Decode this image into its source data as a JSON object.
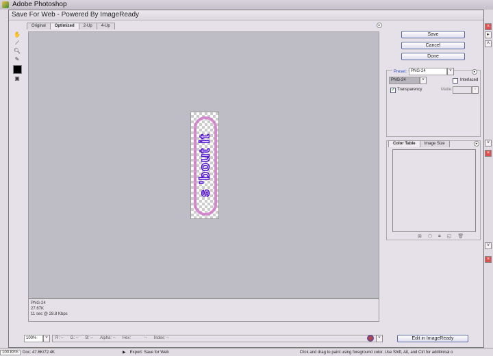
{
  "app": {
    "title": "Adobe Photoshop"
  },
  "dialog": {
    "title": "Save For Web - Powered By ImageReady"
  },
  "tabs": [
    {
      "label": "Original"
    },
    {
      "label": "Optimized"
    },
    {
      "label": "2-Up"
    },
    {
      "label": "4-Up"
    }
  ],
  "canvas": {
    "art_text": "s 'bout it"
  },
  "info": {
    "format": "PNG-24",
    "size": "27.67K",
    "time": "11 sec @ 28.8 Kbps"
  },
  "bottom": {
    "zoom": "100%",
    "r": "R:",
    "r_val": "--",
    "g": "G:",
    "g_val": "--",
    "b": "B:",
    "b_val": "--",
    "alpha": "Alpha:",
    "alpha_val": "--",
    "hex": "Hex:",
    "hex_val": "--",
    "index": "Index:",
    "index_val": "--",
    "edit_button": "Edit in ImageReady"
  },
  "buttons": {
    "save": "Save",
    "cancel": "Cancel",
    "done": "Done"
  },
  "settings": {
    "preset_label": "Preset:",
    "preset_value": "PNG-24",
    "format_value": "PNG-24",
    "interlaced_label": "Interlaced",
    "interlaced": false,
    "transparency_label": "Transparency",
    "transparency": true,
    "matte_label": "Matte:"
  },
  "color_panel": {
    "tabs": [
      {
        "label": "Color Table"
      },
      {
        "label": "Image Size"
      }
    ]
  },
  "status": {
    "zoom": "100.83%",
    "doc": "Doc: 47.6K/72.4K",
    "export": "Export: Save for Web",
    "hint": "Click and drag to paint using foreground color.  Use Shift, Alt, and Ctrl for additional o"
  }
}
